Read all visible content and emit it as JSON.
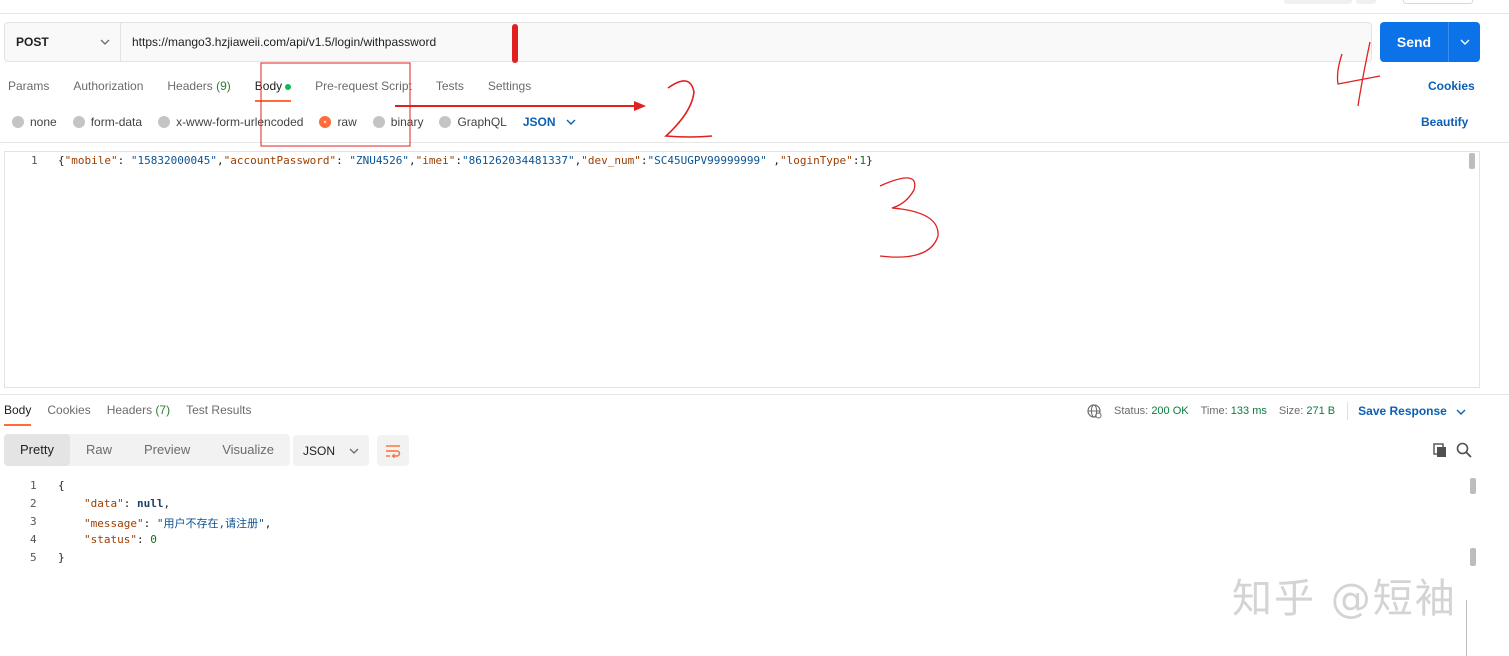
{
  "request": {
    "method": "POST",
    "url": "https://mango3.hzjiaweii.com/api/v1.5/login/withpassword",
    "send_label": "Send"
  },
  "tabs": [
    {
      "label": "Params"
    },
    {
      "label": "Authorization"
    },
    {
      "label": "Headers",
      "count": "(9)"
    },
    {
      "label": "Body",
      "active": true
    },
    {
      "label": "Pre-request Script"
    },
    {
      "label": "Tests"
    },
    {
      "label": "Settings"
    }
  ],
  "cookies_label": "Cookies",
  "beautify_label": "Beautify",
  "body_types": [
    "none",
    "form-data",
    "x-www-form-urlencoded",
    "raw",
    "binary",
    "GraphQL"
  ],
  "body_selected": "raw",
  "body_format": "JSON",
  "request_body": {
    "line_no": "1",
    "parts": [
      {
        "t": "p",
        "v": "{"
      },
      {
        "t": "k",
        "v": "\"mobile\""
      },
      {
        "t": "p",
        "v": ": "
      },
      {
        "t": "s",
        "v": "\"15832000045\""
      },
      {
        "t": "p",
        "v": ","
      },
      {
        "t": "k",
        "v": "\"accountPassword\""
      },
      {
        "t": "p",
        "v": ": "
      },
      {
        "t": "s",
        "v": "\"ZNU4526\""
      },
      {
        "t": "p",
        "v": ","
      },
      {
        "t": "k",
        "v": "\"imei\""
      },
      {
        "t": "p",
        "v": ":"
      },
      {
        "t": "s",
        "v": "\"861262034481337\""
      },
      {
        "t": "p",
        "v": ","
      },
      {
        "t": "k",
        "v": "\"dev_num\""
      },
      {
        "t": "p",
        "v": ":"
      },
      {
        "t": "s",
        "v": "\"SC45UGPV99999999\""
      },
      {
        "t": "p",
        "v": " ,"
      },
      {
        "t": "k",
        "v": "\"loginType\""
      },
      {
        "t": "p",
        "v": ":"
      },
      {
        "t": "n",
        "v": "1"
      },
      {
        "t": "p",
        "v": "}"
      }
    ]
  },
  "response": {
    "tabs": [
      {
        "label": "Body",
        "active": true
      },
      {
        "label": "Cookies"
      },
      {
        "label": "Headers",
        "count": "(7)"
      },
      {
        "label": "Test Results"
      }
    ],
    "status_label": "Status:",
    "status_value": "200 OK",
    "time_label": "Time:",
    "time_value": "133 ms",
    "size_label": "Size:",
    "size_value": "271 B",
    "save_label": "Save Response",
    "views": [
      "Pretty",
      "Raw",
      "Preview",
      "Visualize"
    ],
    "active_view": "Pretty",
    "format": "JSON",
    "lines": [
      {
        "no": "1",
        "text": "{"
      },
      {
        "no": "2",
        "key": "\"data\"",
        "sep": ": ",
        "val": "null",
        "val_type": "kw",
        "tail": ","
      },
      {
        "no": "3",
        "key": "\"message\"",
        "sep": ": ",
        "val": "\"用户不存在,请注册\"",
        "val_type": "str",
        "tail": ","
      },
      {
        "no": "4",
        "key": "\"status\"",
        "sep": ": ",
        "val": "0",
        "val_type": "num",
        "tail": ""
      },
      {
        "no": "5",
        "text": "}"
      }
    ]
  },
  "annotations": {
    "numbers": [
      "1",
      "2",
      "3",
      "4"
    ],
    "color": "#e02020"
  },
  "watermark": "知乎 @短袖",
  "colors": {
    "accent": "#ff6c37",
    "send": "#0b72e7",
    "link": "#0b5fb5",
    "status_ok": "#0a7d3c"
  }
}
